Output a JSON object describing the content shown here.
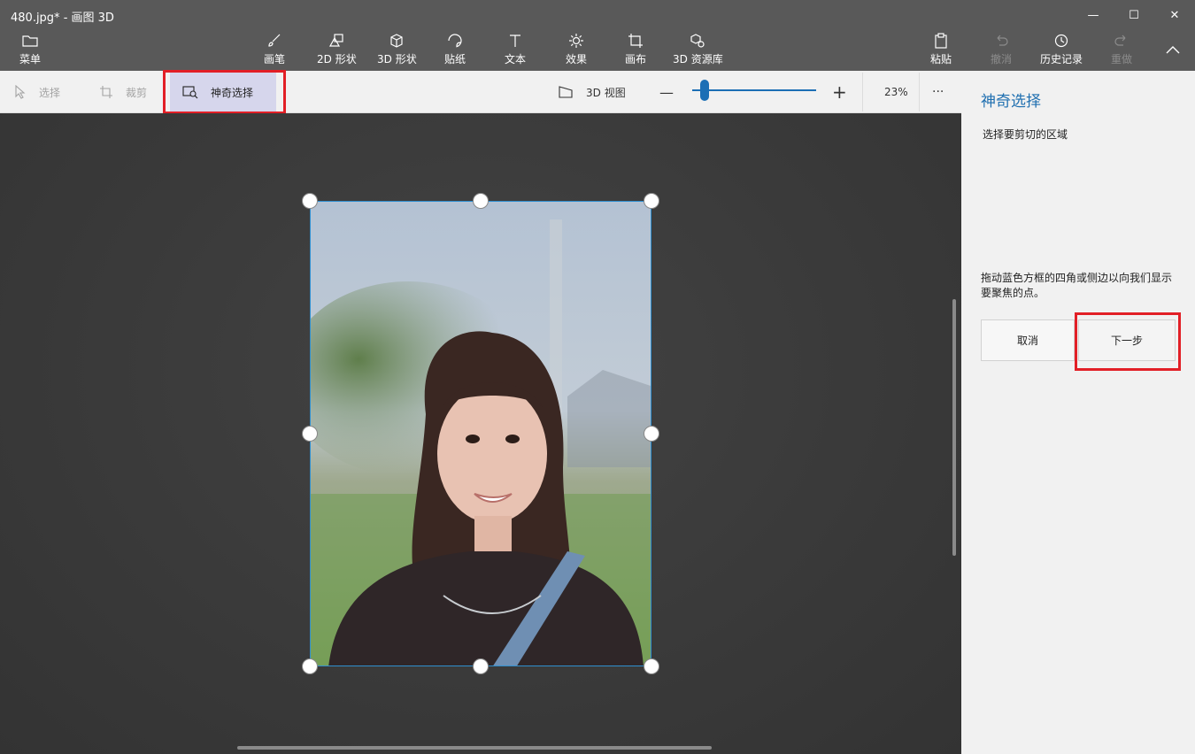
{
  "window": {
    "title": "480.jpg* - 画图 3D",
    "controls": {
      "minimize": "—",
      "maximize": "☐",
      "close": "✕"
    }
  },
  "ribbon": {
    "menu_label": "菜单",
    "tools": [
      {
        "label": "画笔",
        "icon": "brush-icon"
      },
      {
        "label": "2D 形状",
        "icon": "2d-shapes-icon"
      },
      {
        "label": "3D 形状",
        "icon": "3d-shapes-icon"
      },
      {
        "label": "贴纸",
        "icon": "sticker-icon"
      },
      {
        "label": "文本",
        "icon": "text-icon"
      },
      {
        "label": "效果",
        "icon": "effects-icon"
      },
      {
        "label": "画布",
        "icon": "canvas-icon"
      },
      {
        "label": "3D 资源库",
        "icon": "3d-library-icon"
      }
    ],
    "paste_label": "粘贴",
    "undo_label": "撤消",
    "history_label": "历史记录",
    "redo_label": "重做"
  },
  "subbar": {
    "select_label": "选择",
    "crop_label": "裁剪",
    "magic_select_label": "神奇选择",
    "view3d_label": "3D 视图",
    "zoom_minus": "—",
    "zoom_plus": "+",
    "zoom_value": "23%",
    "more": "···"
  },
  "panel": {
    "title": "神奇选择",
    "subtitle": "选择要剪切的区域",
    "description": "拖动蓝色方框的四角或侧边以向我们显示要聚焦的点。",
    "cancel_label": "取消",
    "next_label": "下一步"
  },
  "colors": {
    "accent": "#1c6fb5",
    "highlight": "#e21f26",
    "ribbon_bg": "#595959",
    "panel_bg": "#f1f1f1"
  }
}
